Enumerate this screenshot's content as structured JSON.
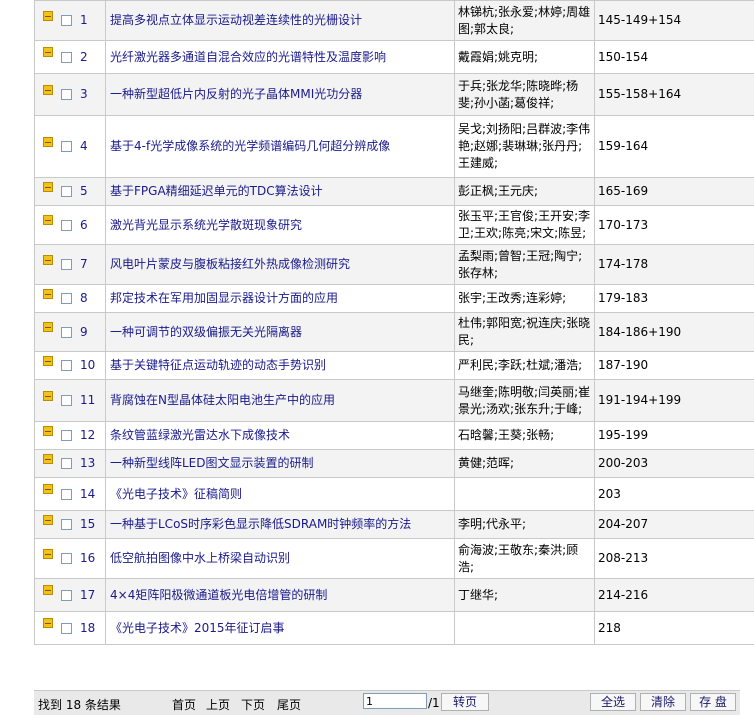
{
  "rows": [
    {
      "num": "1",
      "title": "提高多视点立体显示运动视差连续性的光栅设计",
      "authors": "林锑杭;张永爱;林婷;周雄图;郭太良;",
      "pages": "145-149+154"
    },
    {
      "num": "2",
      "title": "光纤激光器多通道自混合效应的光谱特性及温度影响",
      "authors": "戴霞娟;姚克明;",
      "pages": "150-154"
    },
    {
      "num": "3",
      "title": "一种新型超低片内反射的光子晶体MMI光功分器",
      "authors": "于兵;张龙华;陈晓晔;杨斐;孙小菡;葛俊祥;",
      "pages": "155-158+164"
    },
    {
      "num": "4",
      "title": "基于4-f光学成像系统的光学频谱编码几何超分辨成像",
      "authors": "吴戈;刘扬阳;吕群波;李伟艳;赵娜;裴琳琳;张丹丹;王建威;",
      "pages": "159-164"
    },
    {
      "num": "5",
      "title": "基于FPGA精细延迟单元的TDC算法设计",
      "authors": "彭正枫;王元庆;",
      "pages": "165-169"
    },
    {
      "num": "6",
      "title": "激光背光显示系统光学散斑现象研究",
      "authors": "张玉平;王官俊;王开安;李卫;王欢;陈亮;宋文;陈昱;",
      "pages": "170-173"
    },
    {
      "num": "7",
      "title": "风电叶片蒙皮与腹板粘接红外热成像检测研究",
      "authors": "孟梨雨;曾智;王冠;陶宁;张存林;",
      "pages": "174-178"
    },
    {
      "num": "8",
      "title": "邦定技术在军用加固显示器设计方面的应用",
      "authors": "张宇;王改秀;连彩婷;",
      "pages": "179-183"
    },
    {
      "num": "9",
      "title": "一种可调节的双级偏振无关光隔离器",
      "authors": "杜伟;郭阳宽;祝连庆;张晓民;",
      "pages": "184-186+190"
    },
    {
      "num": "10",
      "title": "基于关键特征点运动轨迹的动态手势识别",
      "authors": "严利民;李跃;杜斌;潘浩;",
      "pages": "187-190"
    },
    {
      "num": "11",
      "title": "背腐蚀在N型晶体硅太阳电池生产中的应用",
      "authors": "马继奎;陈明敬;闫英丽;崔景光;汤欢;张东升;于峰;",
      "pages": "191-194+199"
    },
    {
      "num": "12",
      "title": "条纹管蓝绿激光雷达水下成像技术",
      "authors": "石晗馨;王葵;张畅;",
      "pages": "195-199"
    },
    {
      "num": "13",
      "title": "一种新型线阵LED图文显示装置的研制",
      "authors": "黄健;范晖;",
      "pages": "200-203"
    },
    {
      "num": "14",
      "title": "《光电子技术》征稿简则",
      "authors": "",
      "pages": "203"
    },
    {
      "num": "15",
      "title": "一种基于LCoS时序彩色显示降低SDRAM时钟频率的方法",
      "authors": "李明;代永平;",
      "pages": "204-207"
    },
    {
      "num": "16",
      "title": "低空航拍图像中水上桥梁自动识别",
      "authors": "俞海波;王敬东;秦洪;顾浩;",
      "pages": "208-213"
    },
    {
      "num": "17",
      "title": "4×4矩阵阳极微通道板光电倍增管的研制",
      "authors": "丁继华;",
      "pages": "214-216"
    },
    {
      "num": "18",
      "title": "《光电子技术》2015年征订启事",
      "authors": "",
      "pages": "218"
    }
  ],
  "footer": {
    "found_text": "找到 18 条结果",
    "first": "首页",
    "prev": "上页",
    "next": "下页",
    "last": "尾页",
    "page_value": "1",
    "page_total": "/1",
    "goto": "转页",
    "select_all": "全选",
    "clear": "清除",
    "save": "存 盘"
  },
  "icons": {
    "row_icon": "pdf-download-icon",
    "checkbox": "checkbox-icon"
  },
  "colors": {
    "link": "#1a1a8c",
    "odd_row": "#f3f3f3",
    "even_row": "#ffffff",
    "border": "#c9c9c9",
    "footer_bg": "#e9e9e9"
  }
}
